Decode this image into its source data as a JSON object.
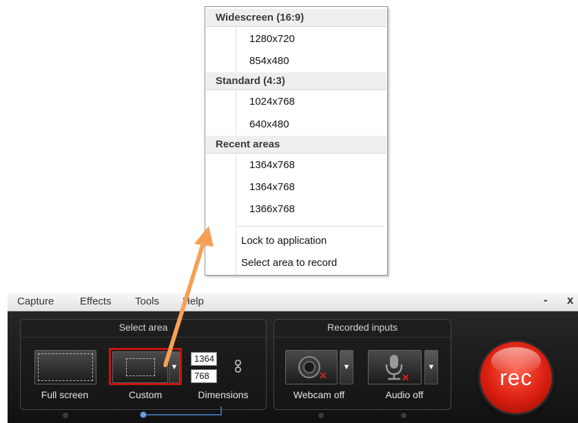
{
  "dropdown": {
    "sections": [
      {
        "header": "Widescreen (16:9)",
        "items": [
          "1280x720",
          "854x480"
        ]
      },
      {
        "header": "Standard (4:3)",
        "items": [
          "1024x768",
          "640x480"
        ]
      },
      {
        "header": "Recent areas",
        "items": [
          "1364x768",
          "1364x768",
          "1366x768"
        ]
      }
    ],
    "actions": [
      "Lock to application",
      "Select area to record"
    ]
  },
  "menubar": {
    "items": [
      "Capture",
      "Effects",
      "Tools",
      "Help"
    ],
    "minimize": "-",
    "close": "x"
  },
  "select_area": {
    "title": "Select area",
    "full_screen_label": "Full screen",
    "custom_label": "Custom",
    "dimensions_label": "Dimensions",
    "width": "1364",
    "height": "768"
  },
  "recorded_inputs": {
    "title": "Recorded inputs",
    "webcam_label": "Webcam off",
    "audio_label": "Audio off"
  },
  "rec_button": "rec",
  "colors": {
    "arrow": "#f7a054",
    "custom_border": "#cc1111",
    "off_badge": "#e02020",
    "rec": "#d91e10"
  }
}
